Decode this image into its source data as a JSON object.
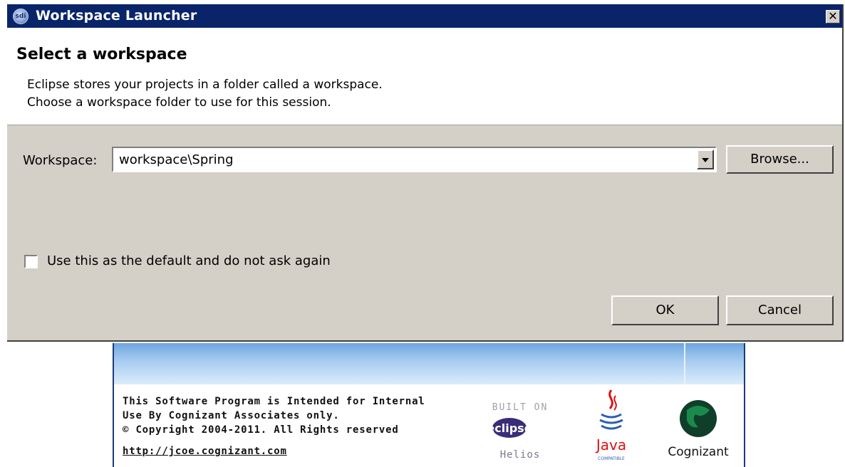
{
  "window": {
    "title": "Workspace Launcher",
    "close_icon": "close-icon",
    "app_icon_text": "sdi"
  },
  "header": {
    "title": "Select a workspace",
    "description_line1": "Eclipse stores your projects in a folder called a workspace.",
    "description_line2": "Choose a workspace folder to use for this session."
  },
  "workspace": {
    "label": "Workspace:",
    "value": "workspace\\Spring",
    "dropdown_icon": "chevron-down-icon",
    "browse_label": "Browse..."
  },
  "checkbox": {
    "label": "Use this as the default and do not ask again",
    "checked": false
  },
  "buttons": {
    "ok_label": "OK",
    "cancel_label": "Cancel"
  },
  "splash": {
    "line1": "This Software Program is Intended for Internal",
    "line2": "Use By Cognizant Associates only.",
    "line3": "© Copyright 2004-2011. All Rights reserved",
    "link": "http://jcoe.cognizant.com",
    "eclipse_built_on": "BUILT ON",
    "eclipse_word": "eclipse",
    "eclipse_release": "Helios",
    "java_word": "Java",
    "java_sub": "COMPATIBLE",
    "cognizant_word": "Cognizant",
    "colors": {
      "java_red": "#e01010",
      "cognizant_green": "#1a8a4a",
      "eclipse_purple": "#4a3a8a"
    }
  }
}
